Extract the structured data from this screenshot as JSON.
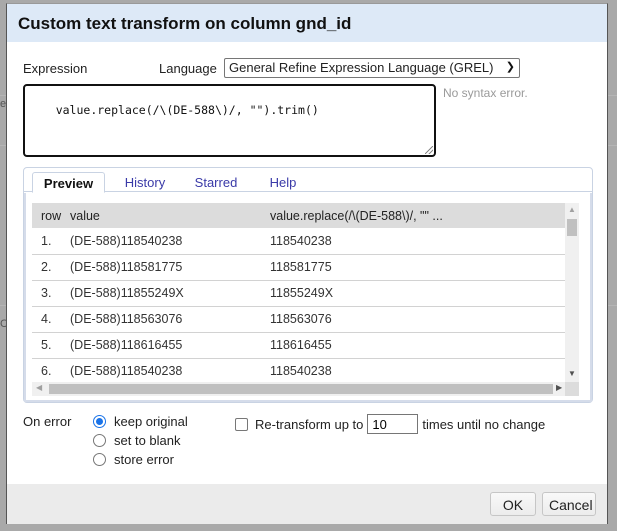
{
  "dialog": {
    "title": "Custom text transform on column gnd_id"
  },
  "expression": {
    "label": "Expression",
    "language_label": "Language",
    "language_selected": "General Refine Expression Language (GREL)",
    "code": "value.replace(/\\(DE-588\\)/, \"\").trim()",
    "syntax_status": "No syntax error."
  },
  "tabs": [
    {
      "label": "Preview",
      "active": true
    },
    {
      "label": "History",
      "active": false
    },
    {
      "label": "Starred",
      "active": false
    },
    {
      "label": "Help",
      "active": false
    }
  ],
  "preview": {
    "columns": [
      "row",
      "value",
      "value.replace(/\\(DE-588\\)/, \"\" ..."
    ],
    "rows": [
      {
        "row": "1.",
        "value": "(DE-588)118540238",
        "result": "118540238"
      },
      {
        "row": "2.",
        "value": "(DE-588)118581775",
        "result": "118581775"
      },
      {
        "row": "3.",
        "value": "(DE-588)11855249X",
        "result": "11855249X"
      },
      {
        "row": "4.",
        "value": "(DE-588)118563076",
        "result": "118563076"
      },
      {
        "row": "5.",
        "value": "(DE-588)118616455",
        "result": "118616455"
      },
      {
        "row": "6.",
        "value": "(DE-588)118540238",
        "result": "118540238"
      }
    ]
  },
  "on_error": {
    "label": "On error",
    "options": [
      {
        "label": "keep original",
        "checked": true
      },
      {
        "label": "set to blank",
        "checked": false
      },
      {
        "label": "store error",
        "checked": false
      }
    ]
  },
  "retransform": {
    "checked": false,
    "label_before": "Re-transform up to",
    "value": "10",
    "label_after": "times until no change"
  },
  "buttons": {
    "ok": "OK",
    "cancel": "Cancel"
  },
  "background": {
    "fragments": [
      "es",
      "C"
    ]
  }
}
